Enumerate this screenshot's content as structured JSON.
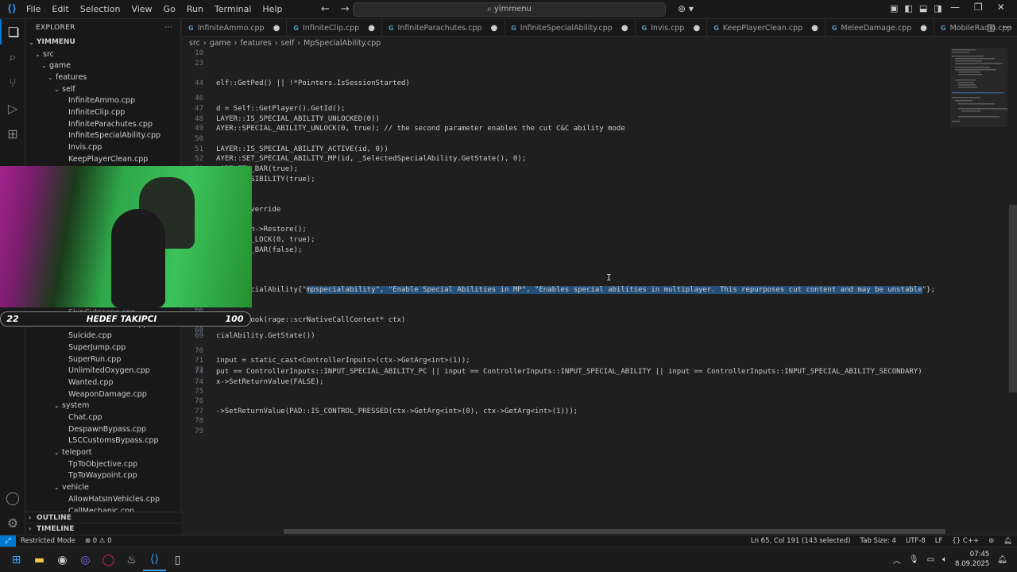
{
  "titlebar": {
    "menu": [
      "File",
      "Edit",
      "Selection",
      "View",
      "Go",
      "Run",
      "Terminal",
      "Help"
    ],
    "search": "yimmenu"
  },
  "explorer": {
    "title": "EXPLORER",
    "root": "YIMMENU",
    "items": [
      {
        "label": "src",
        "indent": 1,
        "chev": "⌄"
      },
      {
        "label": "game",
        "indent": 2,
        "chev": "⌄"
      },
      {
        "label": "features",
        "indent": 3,
        "chev": "⌄"
      },
      {
        "label": "self",
        "indent": 4,
        "chev": "⌄"
      },
      {
        "label": "InfiniteAmmo.cpp",
        "indent": 5
      },
      {
        "label": "InfiniteClip.cpp",
        "indent": 5
      },
      {
        "label": "InfiniteParachutes.cpp",
        "indent": 5
      },
      {
        "label": "InfiniteSpecialAbility.cpp",
        "indent": 5
      },
      {
        "label": "Invis.cpp",
        "indent": 5
      },
      {
        "label": "KeepPlayerClean.cpp",
        "indent": 5
      }
    ],
    "items_lower": [
      {
        "label": "SkipCutscene.cpp",
        "indent": 5,
        "dim": true
      },
      {
        "label": "StandOnVehicles.cpp",
        "indent": 5,
        "dim": true
      },
      {
        "label": "Suicide.cpp",
        "indent": 5
      },
      {
        "label": "SuperJump.cpp",
        "indent": 5
      },
      {
        "label": "SuperRun.cpp",
        "indent": 5
      },
      {
        "label": "UnlimitedOxygen.cpp",
        "indent": 5
      },
      {
        "label": "Wanted.cpp",
        "indent": 5
      },
      {
        "label": "WeaponDamage.cpp",
        "indent": 5
      },
      {
        "label": "system",
        "indent": 4,
        "chev": "⌄"
      },
      {
        "label": "Chat.cpp",
        "indent": 5
      },
      {
        "label": "DespawnBypass.cpp",
        "indent": 5
      },
      {
        "label": "LSCCustomsBypass.cpp",
        "indent": 5
      },
      {
        "label": "teleport",
        "indent": 4,
        "chev": "⌄"
      },
      {
        "label": "TpToObjective.cpp",
        "indent": 5
      },
      {
        "label": "TpToWaypoint.cpp",
        "indent": 5
      },
      {
        "label": "vehicle",
        "indent": 4,
        "chev": "⌄"
      },
      {
        "label": "AllowHatsInVehicles.cpp",
        "indent": 5
      },
      {
        "label": "CallMechanic.cpp",
        "indent": 5
      }
    ],
    "outline": "OUTLINE",
    "timeline": "TIMELINE"
  },
  "tabs": [
    {
      "label": "InfiniteAmmo.cpp",
      "active": false
    },
    {
      "label": "InfiniteClip.cpp",
      "active": false
    },
    {
      "label": "InfiniteParachutes.cpp",
      "active": false
    },
    {
      "label": "InfiniteSpecialAbility.cpp",
      "active": false
    },
    {
      "label": "Invis.cpp",
      "active": false
    },
    {
      "label": "KeepPlayerClean.cpp",
      "active": false
    },
    {
      "label": "MeleeDamage.cpp",
      "active": false
    },
    {
      "label": "MobileRadio.cpp",
      "active": false
    },
    {
      "label": "MpSpecialAbility.cpp",
      "active": true
    }
  ],
  "breadcrumb": [
    "src",
    "game",
    "features",
    "self",
    "MpSpecialAbility.cpp"
  ],
  "code_lines": [
    {
      "n": "10",
      "text": ""
    },
    {
      "n": "23",
      "text": ""
    },
    {
      "n": "44",
      "text": "elf::GetPed() || !*Pointers.IsSessionStarted)"
    },
    {
      "n": "46",
      "text": ""
    },
    {
      "n": "47",
      "text": "d = Self::GetPlayer().GetId();"
    },
    {
      "n": "48",
      "text": "LAYER::IS_SPECIAL_ABILITY_UNLOCKED(0))"
    },
    {
      "n": "49",
      "text": "AYER::SPECIAL_ABILITY_UNLOCK(0, true); // the second parameter enables the cut C&C ability mode"
    },
    {
      "n": "50",
      "text": ""
    },
    {
      "n": "51",
      "text": "LAYER::IS_SPECIAL_ABILITY_ACTIVE(id, 0))"
    },
    {
      "n": "52",
      "text": "AYER::SET_SPECIAL_ABILITY_MP(id, _SelectedSpecialAbility.GetState(), 0);"
    },
    {
      "n": "53",
      "text": "_ABILITY_BAR(true);"
    },
    {
      "n": "54",
      "text": "Y_BAR_VISIBILITY(true);"
    },
    {
      "n": "55",
      "text": ""
    },
    {
      "n": "56",
      "text": ""
    },
    {
      "n": "57",
      "text": "able() override"
    },
    {
      "n": "58",
      "text": ""
    },
    {
      "n": "59",
      "text": "yBarPatch->Restore();"
    },
    {
      "n": "60",
      "text": "_ABILITY_LOCK(0, true);"
    },
    {
      "n": "61",
      "text": "_ABILITY_BAR(false);"
    },
    {
      "n": "62",
      "text": ""
    },
    {
      "n": "63",
      "text": ""
    },
    {
      "n": "64",
      "text": ""
    },
    {
      "n": "65",
      "text_pre": "y _MpSpecialAbility{\"",
      "text_sel": "mpspecialability\", \"Enable Special Abilities in MP\", \"Enables special abilities in multiplayer. This repurposes cut content and may be unstable",
      "text_post": "\"};"
    },
    {
      "n": "66",
      "text": ""
    },
    {
      "n": "67",
      "text": "PressedHook(rage::scrNativeCallContext* ctx)"
    },
    {
      "n": "68",
      "text": ""
    },
    {
      "n": "69",
      "text": "cialAbility.GetState())"
    },
    {
      "n": "70",
      "text": ""
    },
    {
      "n": "71",
      "text": "input = static_cast<ControllerInputs>(ctx->GetArg<int>(1));"
    },
    {
      "n": "72",
      "text": ""
    },
    {
      "n": "73",
      "text": "put == ControllerInputs::INPUT_SPECIAL_ABILITY_PC || input == ControllerInputs::INPUT_SPECIAL_ABILITY || input == ControllerInputs::INPUT_SPECIAL_ABILITY_SECONDARY)"
    },
    {
      "n": "74",
      "text": "x->SetReturnValue(FALSE);"
    },
    {
      "n": "75",
      "text": ""
    },
    {
      "n": "76",
      "text": ""
    },
    {
      "n": "77",
      "text": "->SetReturnValue(PAD::IS_CONTROL_PRESSED(ctx->GetArg<int>(0), ctx->GetArg<int>(1)));"
    },
    {
      "n": "78",
      "text": ""
    },
    {
      "n": "79",
      "text": ""
    }
  ],
  "overlay": {
    "left_number": "22",
    "label": "HEDEF TAKIPCI",
    "right_number": "100"
  },
  "status": {
    "restricted": "Restricted Mode",
    "errors": "⊗ 0 ⚠ 0",
    "position": "Ln 65, Col 191 (143 selected)",
    "tabsize": "Tab Size: 4",
    "encoding": "UTF-8",
    "eol": "LF",
    "language": "{} C++"
  },
  "taskbar": {
    "time": "07:45",
    "date": "8.09.2025"
  },
  "colors": {
    "accent": "#0078d4",
    "selection": "#264f78",
    "background": "#1f1f1f"
  }
}
